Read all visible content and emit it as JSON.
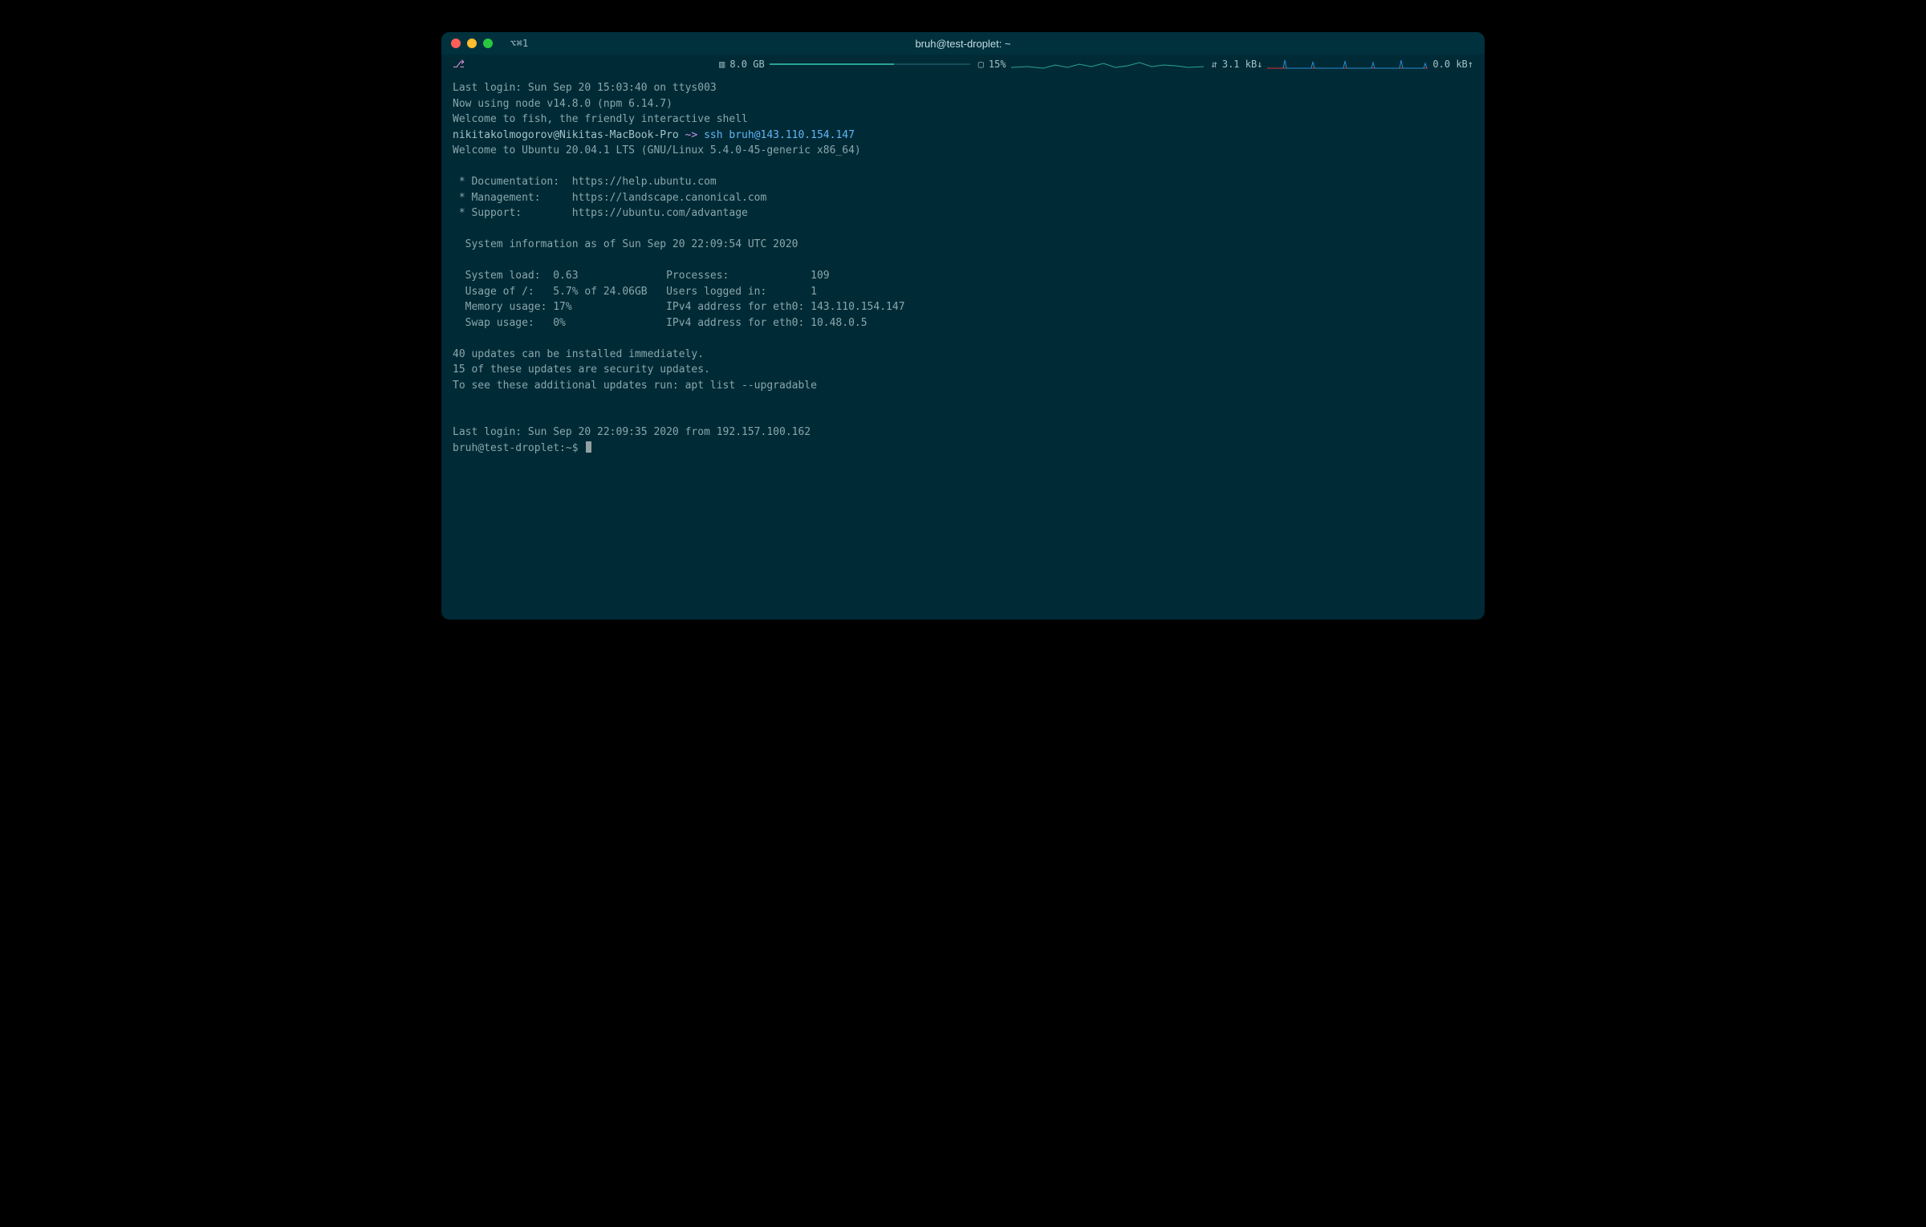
{
  "window": {
    "title": "bruh@test-droplet: ~",
    "tab_label": "⌥⌘1"
  },
  "statusbar": {
    "git_branch_icon": "⎇",
    "mem_icon": "▥",
    "mem_label": "8.0 GB",
    "mem_fill_pct": 62,
    "cpu_icon": "▢",
    "cpu_label": "15%",
    "net_icon": "⇵",
    "net_down": "3.1 kB↓",
    "net_up": "0.0 kB↑"
  },
  "terminal": {
    "lines": [
      "Last login: Sun Sep 20 15:03:40 on ttys003",
      "Now using node v14.8.0 (npm 6.14.7)",
      "Welcome to fish, the friendly interactive shell"
    ],
    "local_prompt": "nikitakolmogorov@Nikitas-MacBook-Pro",
    "local_prompt_arrow": "~>",
    "local_cmd": "ssh",
    "local_cmd_arg": "bruh@143.110.154.147",
    "motd": [
      "Welcome to Ubuntu 20.04.1 LTS (GNU/Linux 5.4.0-45-generic x86_64)",
      "",
      " * Documentation:  https://help.ubuntu.com",
      " * Management:     https://landscape.canonical.com",
      " * Support:        https://ubuntu.com/advantage",
      "",
      "  System information as of Sun Sep 20 22:09:54 UTC 2020",
      "",
      "  System load:  0.63              Processes:             109",
      "  Usage of /:   5.7% of 24.06GB   Users logged in:       1",
      "  Memory usage: 17%               IPv4 address for eth0: 143.110.154.147",
      "  Swap usage:   0%                IPv4 address for eth0: 10.48.0.5",
      "",
      "40 updates can be installed immediately.",
      "15 of these updates are security updates.",
      "To see these additional updates run: apt list --upgradable",
      "",
      "",
      "Last login: Sun Sep 20 22:09:35 2020 from 192.157.100.162"
    ],
    "remote_prompt": "bruh@test-droplet:~$"
  },
  "colors": {
    "bg": "#002b36",
    "fg": "#8ba6ad",
    "titlebar": "#00313d",
    "accent": "#2aa198"
  }
}
